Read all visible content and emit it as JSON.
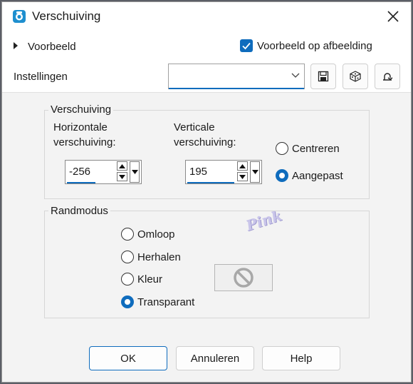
{
  "window": {
    "title": "Verschuiving"
  },
  "top": {
    "preview_label": "Voorbeeld",
    "preview_on_image_label": "Voorbeeld op afbeelding",
    "preview_on_image_checked": true,
    "settings_label": "Instellingen",
    "settings_value": ""
  },
  "offset": {
    "group_title": "Verschuiving",
    "horizontal_label_1": "Horizontale",
    "horizontal_label_2": "verschuiving:",
    "horizontal_value": "-256",
    "vertical_label_1": "Verticale",
    "vertical_label_2": "verschuiving:",
    "vertical_value": "195",
    "center_label": "Centreren",
    "custom_label": "Aangepast",
    "selected": "custom"
  },
  "edge": {
    "group_title": "Randmodus",
    "wrap_label": "Omloop",
    "repeat_label": "Herhalen",
    "color_label": "Kleur",
    "transparent_label": "Transparant",
    "selected": "transparent"
  },
  "watermark": "Pink",
  "buttons": {
    "ok": "OK",
    "cancel": "Annuleren",
    "help": "Help"
  },
  "colors": {
    "accent": "#0f6cbd",
    "dialog_bg": "#f3f3f3"
  }
}
